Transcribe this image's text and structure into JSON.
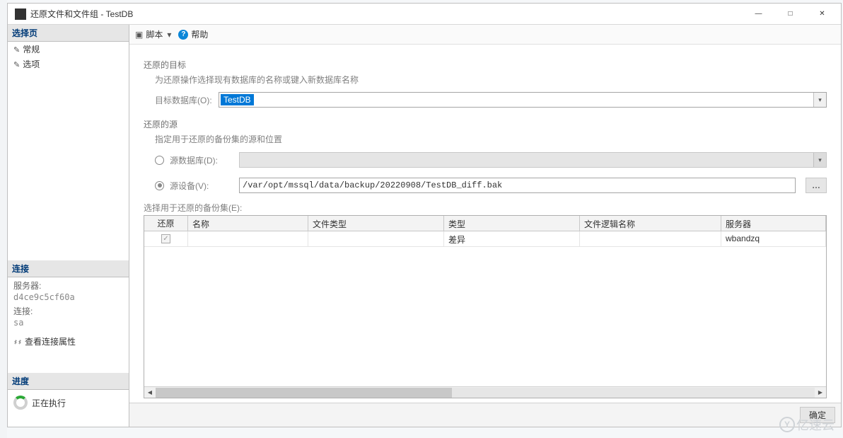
{
  "window": {
    "title": "还原文件和文件组 - TestDB"
  },
  "sidebar": {
    "select_page": "选择页",
    "items": [
      "常规",
      "选项"
    ],
    "connection_header": "连接",
    "server_label": "服务器:",
    "server_value": "d4ce9c5cf60a",
    "conn_label": "连接:",
    "conn_value": "sa",
    "view_conn": "查看连接属性",
    "progress_header": "进度",
    "progress_text": "正在执行"
  },
  "toolbar": {
    "script": "脚本",
    "help": "帮助"
  },
  "form": {
    "dest_title": "还原的目标",
    "dest_sub": "为还原操作选择现有数据库的名称或键入新数据库名称",
    "target_db_label": "目标数据库(O):",
    "target_db_value": "TestDB",
    "source_title": "还原的源",
    "source_sub": "指定用于还原的备份集的源和位置",
    "source_db_label": "源数据库(D):",
    "source_db_value": "",
    "device_label": "源设备(V):",
    "device_value": "/var/opt/mssql/data/backup/20220908/TestDB_diff.bak",
    "grid_label": "选择用于还原的备份集(E):"
  },
  "grid": {
    "headers": [
      "还原",
      "名称",
      "文件类型",
      "类型",
      "文件逻辑名称",
      "服务器"
    ],
    "rows": [
      {
        "restore": true,
        "name": "",
        "file_type": "",
        "type": "差异",
        "logical": "",
        "server": "wbandzq"
      }
    ]
  },
  "buttons": {
    "ok": "确定",
    "cancel": ""
  },
  "watermark": "亿速云"
}
